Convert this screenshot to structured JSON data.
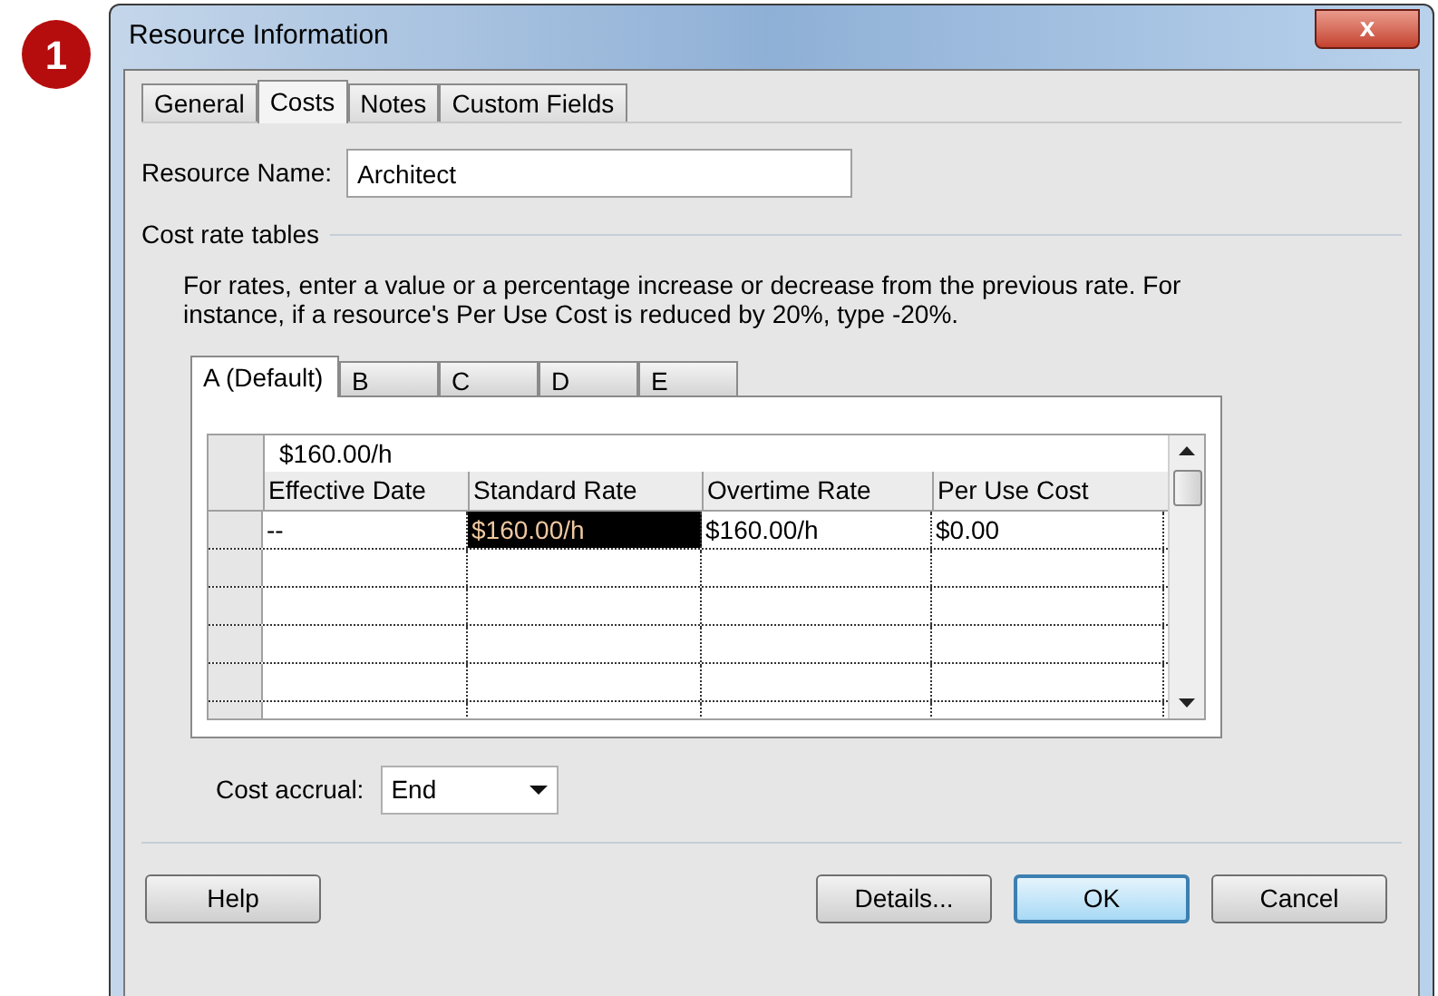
{
  "step_badge": "1",
  "window": {
    "title": "Resource Information",
    "close": "x"
  },
  "tabs": [
    {
      "label": "General",
      "selected": false
    },
    {
      "label": "Costs",
      "selected": true
    },
    {
      "label": "Notes",
      "selected": false
    },
    {
      "label": "Custom Fields",
      "selected": false
    }
  ],
  "resource_name": {
    "label": "Resource Name:",
    "value": "Architect"
  },
  "cost_rate_tables": {
    "heading": "Cost rate tables",
    "instructions": "For rates, enter a value or a percentage increase or decrease from the previous rate. For instance, if a resource's Per Use Cost is reduced by 20%, type -20%.",
    "tabs": [
      {
        "label": "A (Default)",
        "selected": true
      },
      {
        "label": "B",
        "selected": false
      },
      {
        "label": "C",
        "selected": false
      },
      {
        "label": "D",
        "selected": false
      },
      {
        "label": "E",
        "selected": false
      }
    ],
    "edit_bar": "$160.00/h",
    "columns": [
      "Effective Date",
      "Standard Rate",
      "Overtime Rate",
      "Per Use Cost"
    ],
    "rows": [
      [
        {
          "text": "--",
          "selected": false
        },
        {
          "text": "$160.00/h",
          "selected": true
        },
        {
          "text": "$160.00/h",
          "selected": false
        },
        {
          "text": "$0.00",
          "selected": false
        }
      ],
      [
        {
          "selected": false
        },
        {
          "selected": false
        },
        {
          "selected": false
        },
        {
          "selected": false
        }
      ],
      [
        {
          "selected": false
        },
        {
          "selected": false
        },
        {
          "selected": false
        },
        {
          "selected": false
        }
      ],
      [
        {
          "selected": false
        },
        {
          "selected": false
        },
        {
          "selected": false
        },
        {
          "selected": false
        }
      ],
      [
        {
          "selected": false
        },
        {
          "selected": false
        },
        {
          "selected": false
        },
        {
          "selected": false
        }
      ],
      [
        {
          "selected": false
        },
        {
          "selected": false
        },
        {
          "selected": false
        },
        {
          "selected": false
        }
      ]
    ]
  },
  "cost_accrual": {
    "label": "Cost accrual:",
    "value": "End"
  },
  "buttons": [
    {
      "label": "Help",
      "default": false
    },
    {
      "label": "Details...",
      "default": false
    },
    {
      "label": "OK",
      "default": true
    },
    {
      "label": "Cancel",
      "default": false
    }
  ]
}
